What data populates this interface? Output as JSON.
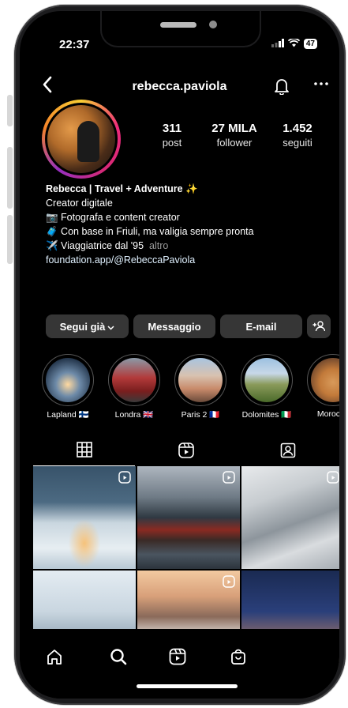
{
  "status": {
    "time": "22:37",
    "battery": "47"
  },
  "header": {
    "username": "rebecca.paviola"
  },
  "stats": [
    {
      "value": "311",
      "label": "post"
    },
    {
      "value": "27 MILA",
      "label": "follower"
    },
    {
      "value": "1.452",
      "label": "seguiti"
    }
  ],
  "bio": {
    "name": "Rebecca | Travel + Adventure ✨",
    "category": "Creator digitale",
    "line1": "📷 Fotografa e content creator",
    "line2": "🧳 Con base in Friuli, ma valigia sempre pronta",
    "line3": "✈️ Viaggiatrice dal '95",
    "more": "altro",
    "link": "foundation.app/@RebeccaPaviola"
  },
  "actions": {
    "follow": "Segui già",
    "message": "Messaggio",
    "email": "E-mail"
  },
  "highlights": [
    {
      "label": "Lapland 🇫🇮"
    },
    {
      "label": "Londra 🇬🇧"
    },
    {
      "label": "Paris 2 🇫🇷"
    },
    {
      "label": "Dolomites 🇮🇹"
    },
    {
      "label": "Morocco"
    }
  ],
  "colors": {
    "background": "#000000",
    "button": "#363636",
    "text": "#ffffff"
  }
}
